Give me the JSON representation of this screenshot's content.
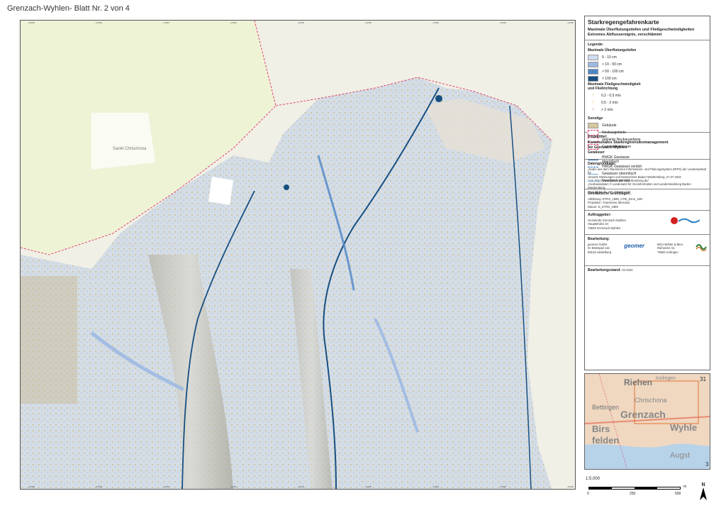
{
  "sheet_title": "Grenzach-Wyhlen- Blatt Nr. 2 von 4",
  "map": {
    "place_label": "Sankt Chrischona",
    "x_ticks_top": [
      "~10000",
      "~10500",
      "~11000",
      "~11500",
      "~12000",
      "~12500",
      "~13000",
      "~13500",
      "~14000"
    ],
    "x_ticks_bottom": [
      "~10000",
      "~10500",
      "~11000",
      "~11500",
      "~12000",
      "~12500",
      "~13000",
      "~13500",
      "~14000"
    ]
  },
  "legend": {
    "title": "Starkregengefahrenkarte",
    "subtitle_1": "Maximale Überflutungstiefen und Fließgeschwindigkeiten",
    "subtitle_2": "Extremes Abflussereignis, verschlämmt",
    "legend_label": "Legende:",
    "depth_heading": "Maximale Überflutungstiefen",
    "depth_classes": [
      {
        "label": "5 - 10 cm",
        "color": "#cfdcf0"
      },
      {
        "label": "> 10 - 50 cm",
        "color": "#9db9e2"
      },
      {
        "label": "> 50 - 100 cm",
        "color": "#4f86c6"
      },
      {
        "label": "> 100 cm",
        "color": "#174f80"
      }
    ],
    "velocity_heading_1": "Maximale Fließgeschwindigkeit",
    "velocity_heading_2": "und Fließrichtung",
    "velocity_classes": [
      {
        "label": "0,2 - 0,5 m/s",
        "color": "#c9a040"
      },
      {
        "label": "0,5 - 2 m/s",
        "color": "#e08a1e"
      },
      {
        "label": "> 2 m/s",
        "color": "#d0201a"
      }
    ],
    "other_heading": "Sonstige",
    "other_items": [
      {
        "label": "Gebäude",
        "color": "#d8c7a0"
      },
      {
        "label": "Neubaugebiete",
        "color": "#ffffff"
      },
      {
        "label": "geplante Neubaugebiete",
        "color": "#ffffff"
      },
      {
        "label": "Gemeindegrenzen",
        "color": "#ffffff"
      }
    ],
    "water_heading": "Gewässer",
    "water_items": [
      {
        "label": "HWGK Gewässer oberirdisch"
      },
      {
        "label": "HWGK Gewässer verdolt"
      },
      {
        "label": "Gewässer oberirdisch"
      },
      {
        "label": "Gewässer verdolt"
      }
    ]
  },
  "project": {
    "heading": "Projekttitel:",
    "title_1": "Kommunales Starkregenrisikomanagement",
    "title_2": "für Grenzach-Wyhlen",
    "basis_heading": "Datengrundlage:",
    "basis_lines": [
      "„Daten aus dem Räumlichen Informations- und Planungssystem (RIPS) der Landesanstalt für",
      "Umwelt, Messungen und Naturschutz Baden-Württemberg, 27.07.2022",
      "Link: http://www.lubw.baden-wuerttemberg.de/",
      "„Geobasisdaten © Landesamt für Geoinformation und Landentwicklung Baden-Württemberg,",
      "www.lgl-bw.de, Az.: 2851.9-1/19“"
    ],
    "geo_heading": "Geodätische Grundlagen:",
    "geo_lines": [
      "Abbildung: ETRS_1989_UTM_Zone_32N",
      "Projektion: Transverse Mercator",
      "Datum: D_ETRS_1989"
    ],
    "client_heading": "Auftraggeber:",
    "client_lines": [
      "Gemeinde Grenzach-Wyhlen",
      "Hauptstraße 10",
      "79639 Grenzach-Wyhlen"
    ],
    "contractor_heading": "Bearbeitung:",
    "contractor_1": [
      "geomer GmbH",
      "Im Breitspiel 11b",
      "69126 Heidelberg"
    ],
    "contractor_1_logo": "geomer",
    "contractor_2": [
      "BGU Bühler & Bleu",
      "Riehenstr. 51",
      "79594 Inzlingen"
    ],
    "date_heading": "Bearbeitungsstand:",
    "date_value": "04.2024"
  },
  "inset": {
    "labels": [
      "Riehen",
      "Bettingen",
      "Grenzach",
      "Wyhle",
      "Birs",
      "felden",
      "Augst",
      "Chrischona",
      "Inzlingen"
    ],
    "sheet_numbers": [
      "31",
      "3"
    ]
  },
  "scale": {
    "ratio": "1:5.000",
    "ticks": [
      "0",
      "250",
      "500"
    ],
    "unit": "m",
    "north": "N"
  },
  "colors": {
    "flood_light": "#cfdcf0",
    "flood_mid": "#9db9e2",
    "flood_dark": "#174f80",
    "boundary": "#e0446e"
  }
}
